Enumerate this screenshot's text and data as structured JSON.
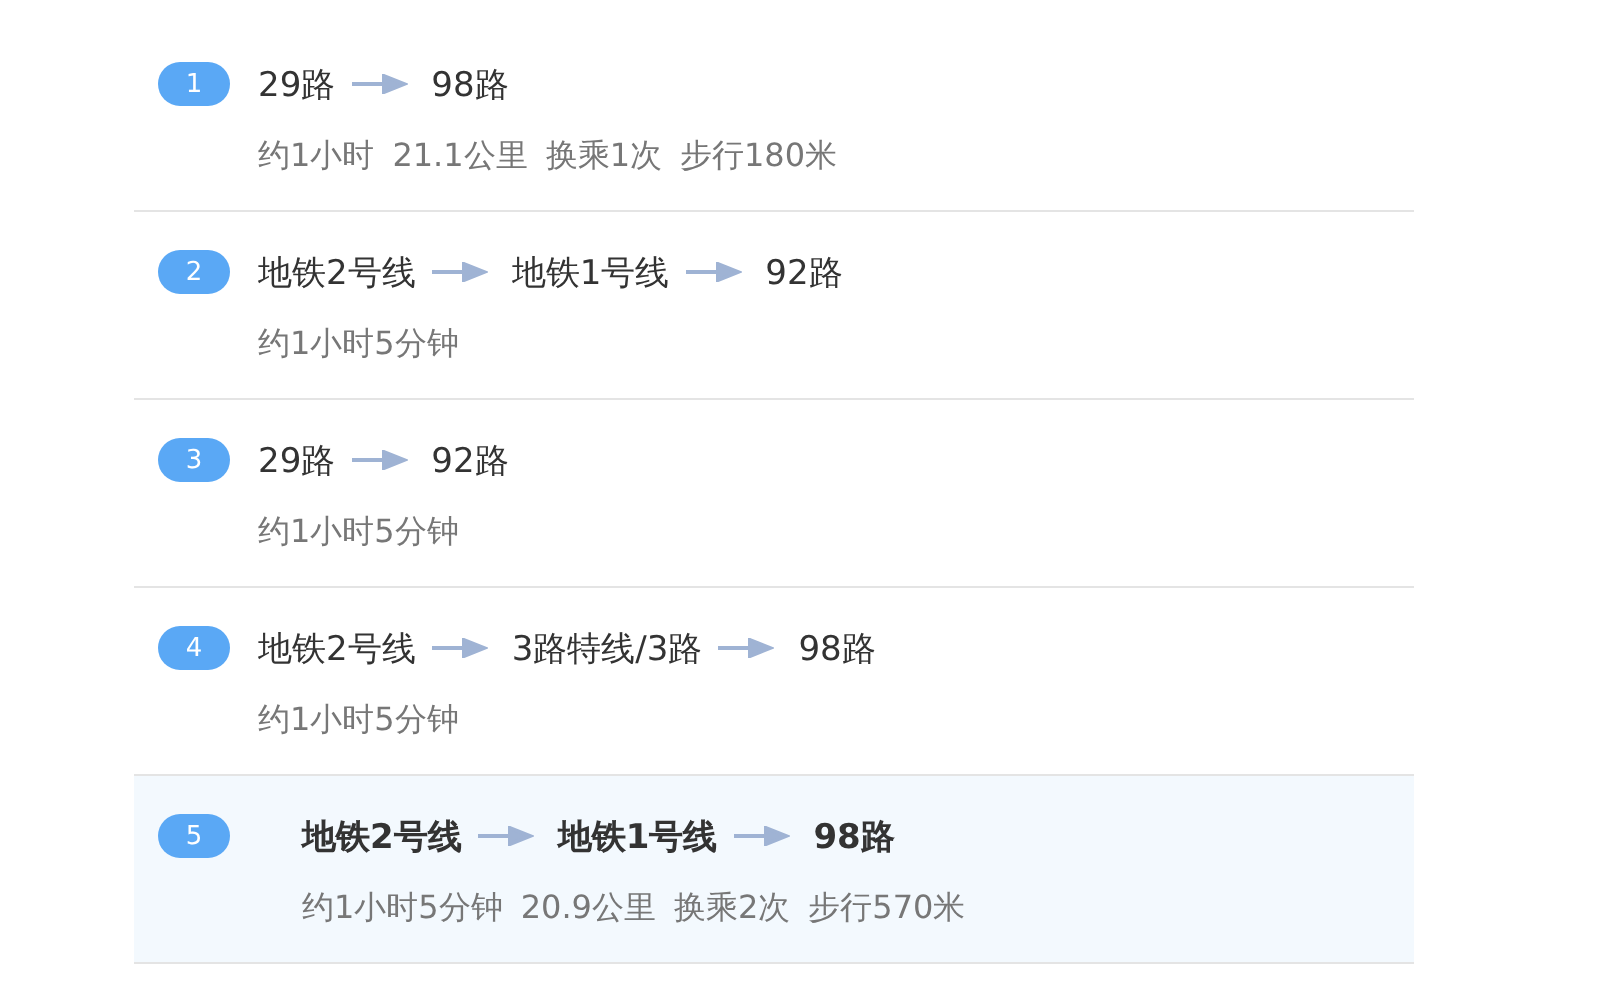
{
  "routes": [
    {
      "number": "1",
      "selected": false,
      "segments": [
        "29路",
        "98路"
      ],
      "details": [
        "约1小时",
        "21.1公里",
        "换乘1次",
        "步行180米"
      ]
    },
    {
      "number": "2",
      "selected": false,
      "segments": [
        "地铁2号线",
        "地铁1号线",
        "92路"
      ],
      "details": [
        "约1小时5分钟"
      ]
    },
    {
      "number": "3",
      "selected": false,
      "segments": [
        "29路",
        "92路"
      ],
      "details": [
        "约1小时5分钟"
      ]
    },
    {
      "number": "4",
      "selected": false,
      "segments": [
        "地铁2号线",
        "3路特线/3路",
        "98路"
      ],
      "details": [
        "约1小时5分钟"
      ]
    },
    {
      "number": "5",
      "selected": true,
      "segments": [
        "地铁2号线",
        "地铁1号线",
        "98路"
      ],
      "details": [
        "约1小时5分钟",
        "20.9公里",
        "换乘2次",
        "步行570米"
      ]
    }
  ]
}
